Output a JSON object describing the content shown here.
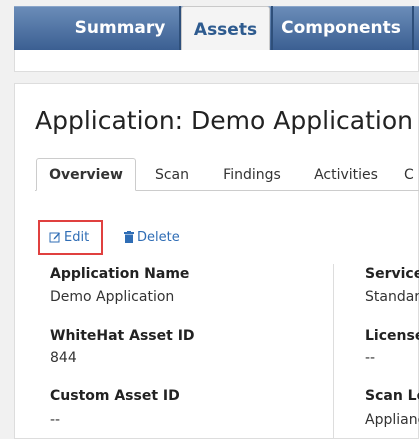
{
  "top_tabs": {
    "summary": "Summary",
    "assets": "Assets",
    "components": "Components"
  },
  "page_title": "Application: Demo Application",
  "sub_tabs": [
    "Overview",
    "Scan",
    "Findings",
    "Activities",
    "C"
  ],
  "actions": {
    "edit_label": "Edit",
    "delete_label": "Delete"
  },
  "fields_left": [
    {
      "label": "Application Name",
      "value": "Demo Application"
    },
    {
      "label": "WhiteHat Asset ID",
      "value": "844"
    },
    {
      "label": "Custom Asset ID",
      "value": "--"
    }
  ],
  "fields_right": [
    {
      "label": "Service",
      "value": "Standard"
    },
    {
      "label": "License",
      "value": "--"
    },
    {
      "label": "Scan Lo",
      "value": "Applianc"
    }
  ],
  "colors": {
    "nav_bar": "#3b5f92",
    "link": "#2f6db5",
    "highlight_border": "#e0403f"
  },
  "icons": {
    "edit": "edit-icon",
    "delete": "trash-icon"
  }
}
